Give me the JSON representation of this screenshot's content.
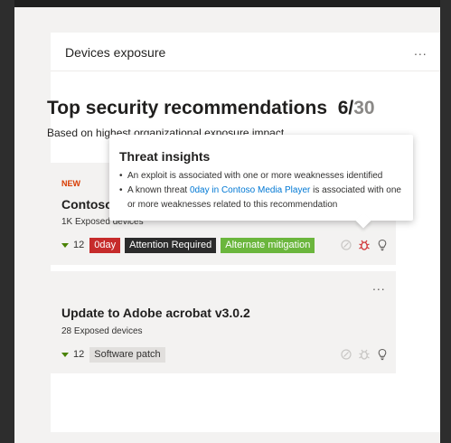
{
  "card": {
    "title": "Devices exposure",
    "more_label": "..."
  },
  "recommendations": {
    "heading": "Top security recommendations",
    "count_shown": "6",
    "count_separator": "/",
    "count_total": "30",
    "subtitle": "Based on highest organizational exposure impact"
  },
  "items": [
    {
      "badge": "NEW",
      "name": "Contoso Media Player",
      "meta": "1K Exposed devices",
      "change": "12",
      "tags": [
        "0day",
        "Attention Required",
        "Alternate mitigation"
      ]
    },
    {
      "more_label": "...",
      "name": "Update to Adobe acrobat v3.0.2",
      "meta": "28 Exposed devices",
      "change": "12",
      "tags": [
        "Software patch"
      ]
    }
  ],
  "tooltip": {
    "title": "Threat insights",
    "bullet1": "An exploit is associated with one or more weaknesses identified",
    "bullet2_prefix": "A known threat ",
    "bullet2_link": "0day in Contoso Media Player",
    "bullet2_suffix": " is associated with one or more weaknesses related to this recommendation"
  },
  "colors": {
    "zero_day": "#c62b2b",
    "attention": "#2b2b2b",
    "mitigation": "#6bb63d",
    "new_badge": "#d83b01",
    "trend_down": "#498205",
    "link": "#0078d4"
  },
  "icons": [
    "exploit-icon",
    "threat-bug-icon",
    "insight-lightbulb-icon"
  ]
}
